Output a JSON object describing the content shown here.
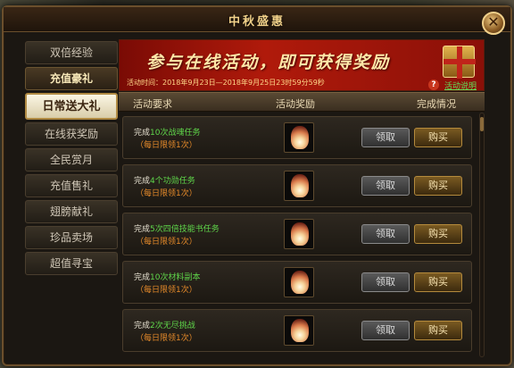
{
  "window": {
    "title": "中秋盛惠",
    "close_symbol": "✕"
  },
  "sidebar": {
    "items": [
      {
        "label": "双倍经验"
      },
      {
        "label": "充值豪礼"
      },
      {
        "label": "日常送大礼",
        "selected": true
      },
      {
        "label": "在线获奖励"
      },
      {
        "label": "全民赏月"
      },
      {
        "label": "充值售礼"
      },
      {
        "label": "翅膀献礼"
      },
      {
        "label": "珍品卖场"
      },
      {
        "label": "超值寻宝"
      }
    ]
  },
  "banner": {
    "headline": "参与在线活动，即可获得奖励",
    "time_label": "活动时间：",
    "time_value": "2018年9月23日—2018年9月25日23时59分59秒",
    "help_symbol": "?",
    "help_link": "活动说明",
    "gift_icon": "gift-box-icon"
  },
  "columns": {
    "requirement": "活动要求",
    "reward": "活动奖励",
    "status": "完成情况"
  },
  "rows": [
    {
      "prefix": "完成",
      "task": "10次战魂任务",
      "limit": "（每日限领1次）",
      "reward_icon": "lantern-icon",
      "claim": "领取",
      "buy": "购买"
    },
    {
      "prefix": "完成",
      "task": "4个功勋任务",
      "limit": "（每日限领1次）",
      "reward_icon": "lantern-icon",
      "claim": "领取",
      "buy": "购买"
    },
    {
      "prefix": "完成",
      "task": "5次四倍技能书任务",
      "limit": "（每日限领1次）",
      "reward_icon": "lantern-icon",
      "claim": "领取",
      "buy": "购买"
    },
    {
      "prefix": "完成",
      "task": "10次材料副本",
      "limit": "（每日限领1次）",
      "reward_icon": "lantern-icon",
      "claim": "领取",
      "buy": "购买"
    },
    {
      "prefix": "完成",
      "task": "2次无尽挑战",
      "limit": "（每日限领1次）",
      "reward_icon": "lantern-icon",
      "claim": "领取",
      "buy": "购买"
    }
  ]
}
